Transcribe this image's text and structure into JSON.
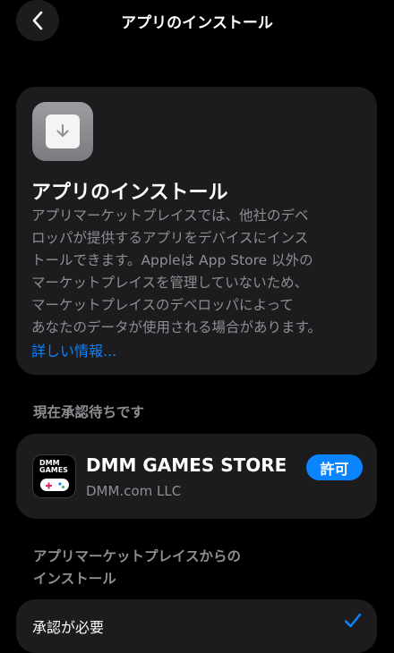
{
  "nav": {
    "title": "アプリのインストール",
    "back_icon": "chevron-left-icon"
  },
  "info_card": {
    "icon": "download-icon",
    "title": "アプリのインストール",
    "body_lines": [
      "アプリマーケットプレイスでは、他社のデベ",
      "ロッパが提供するアプリをデバイスにインス",
      "トールできます。Appleは App Store 以外の",
      "マーケットプレイスを管理していないため、",
      "マーケットプレイスのデベロッパによって",
      "あなたのデータが使用される場合があります。"
    ],
    "link": "詳しい情報..."
  },
  "pending": {
    "header": "現在承認待ちです",
    "app": {
      "icon": "dmm-games-icon",
      "icon_wordmark": "DMM GAMES",
      "name": "DMM GAMES STORE",
      "developer": "DMM.com LLC",
      "action_label": "許可"
    }
  },
  "marketplace_install": {
    "header_lines": [
      "アプリマーケットプレイスからの",
      "インストール"
    ],
    "option": {
      "label": "承認が必要",
      "selected": true,
      "check_icon": "checkmark-icon"
    }
  },
  "colors": {
    "background": "#000000",
    "card": "#1c1c1e",
    "secondary_text": "#8e8e93",
    "accent": "#0a84ff"
  }
}
